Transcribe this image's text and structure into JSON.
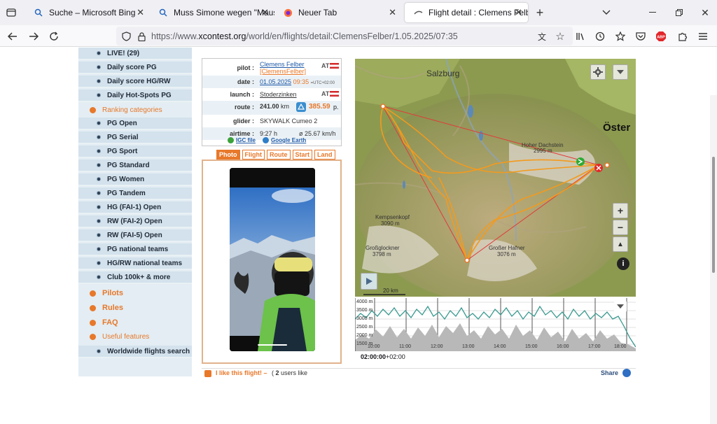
{
  "tabs": [
    {
      "title": "Suche – Microsoft Bing",
      "icon": "search-icon"
    },
    {
      "title": "Muss Simone wegen \"Mausi\" di",
      "icon": "search-icon"
    },
    {
      "title": "Neuer Tab",
      "icon": "firefox-icon"
    },
    {
      "title": "Flight detail : Clemens Felber - X",
      "icon": "xcontest-icon"
    }
  ],
  "url": {
    "prefix": "https://www.",
    "domain": "xcontest.org",
    "path": "/world/en/flights/detail:ClemensFelber/1.05.2025/07:35"
  },
  "sidebar": {
    "items": [
      {
        "label": "LIVE! (29)",
        "type": "sub"
      },
      {
        "label": "Daily score PG",
        "type": "sub"
      },
      {
        "label": "Daily score HG/RW",
        "type": "sub"
      },
      {
        "label": "Daily Hot-Spots PG",
        "type": "sub"
      },
      {
        "label": "Ranking categories",
        "type": "cat"
      },
      {
        "label": "PG Open",
        "type": "sub"
      },
      {
        "label": "PG Serial",
        "type": "sub"
      },
      {
        "label": "PG Sport",
        "type": "sub"
      },
      {
        "label": "PG Standard",
        "type": "sub"
      },
      {
        "label": "PG Women",
        "type": "sub"
      },
      {
        "label": "PG Tandem",
        "type": "sub"
      },
      {
        "label": "HG (FAI-1) Open",
        "type": "sub"
      },
      {
        "label": "RW (FAI-2) Open",
        "type": "sub"
      },
      {
        "label": "RW (FAI-5) Open",
        "type": "sub"
      },
      {
        "label": "PG national teams",
        "type": "sub"
      },
      {
        "label": "HG/RW national teams",
        "type": "sub"
      },
      {
        "label": "Club 100k+ & more",
        "type": "sub"
      },
      {
        "label": "Pilots",
        "type": "catbold"
      },
      {
        "label": "Rules",
        "type": "catbold"
      },
      {
        "label": "FAQ",
        "type": "catbold"
      },
      {
        "label": "Useful features",
        "type": "cat"
      },
      {
        "label": "Worldwide flights search",
        "type": "sub"
      }
    ]
  },
  "flight": {
    "pilot_label": "pilot :",
    "pilot_name": "Clemens Felber",
    "pilot_user": "[ClemensFelber]",
    "pilot_country": "AT",
    "date_label": "date :",
    "date": "01.05.2025",
    "time": "09:35",
    "utc": "=UTC+02:00",
    "launch_label": "launch :",
    "launch": "Stoderzinken",
    "launch_country": "AT",
    "route_label": "route :",
    "route_km": "241.00",
    "route_km_unit": "km",
    "route_points": "385.59",
    "route_points_unit": "p.",
    "glider_label": "glider :",
    "glider": "SKYWALK Cumeo 2",
    "airtime_label": "airtime :",
    "airtime": "9:27 h",
    "avg_speed": "ø 25.67 km/h",
    "igc_label": "IGC file",
    "google_earth_label": "Google Earth"
  },
  "detail_tabs": [
    "Photo",
    "Flight",
    "Route",
    "Start",
    "Land"
  ],
  "map": {
    "labels": {
      "salzburg": "Salzburg",
      "oster": "Öster",
      "dachstein": "Hoher Dachstein",
      "dachstein_alt": "2995 m",
      "kemp": "Kempsenkopf",
      "kemp_alt": "3090 m",
      "glockner": "Großglockner",
      "glockner_alt": "3798 m",
      "hafner": "Großer Hafner",
      "hafner_alt": "3076 m",
      "scale": "20 km"
    }
  },
  "profile": {
    "alt_labels": [
      "4000 m",
      "3500 m",
      "3000 m",
      "2500 m",
      "2000 m",
      "1500 m"
    ],
    "time_labels": [
      "10:00",
      "11:00",
      "12:00",
      "13:00",
      "14:00",
      "15:00",
      "16:00",
      "17:00",
      "18:00"
    ],
    "current_time": "02:00:00",
    "current_tz": "+02:00"
  },
  "like": {
    "label": "I like this flight! –",
    "count": "2",
    "count_suffix": "users like",
    "share": "Share"
  },
  "colors": {
    "accent": "#e8782a",
    "link": "#1f5aa6",
    "sidebar": "#e3edf3"
  }
}
